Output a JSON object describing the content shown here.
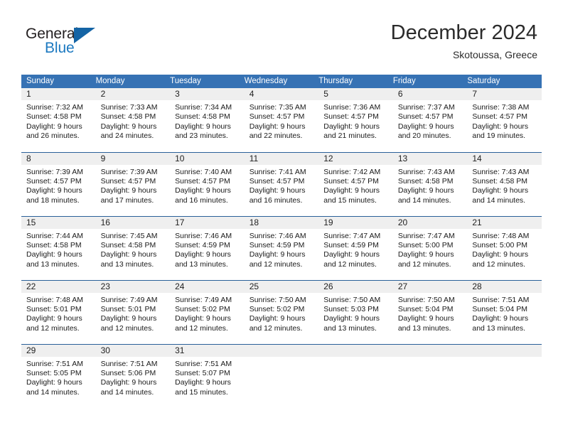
{
  "brand": {
    "name_part1": "General",
    "name_part2": "Blue"
  },
  "header": {
    "title": "December 2024",
    "location": "Skotoussa, Greece"
  },
  "colors": {
    "header_blue": "#3672b4",
    "row_border_blue": "#2a6099",
    "daynum_bg": "#efefef",
    "logo_blue": "#1c79c0",
    "logo_dark": "#231f20"
  },
  "weekdays": [
    "Sunday",
    "Monday",
    "Tuesday",
    "Wednesday",
    "Thursday",
    "Friday",
    "Saturday"
  ],
  "weeks": [
    [
      {
        "day": "1",
        "sunrise": "Sunrise: 7:32 AM",
        "sunset": "Sunset: 4:58 PM",
        "daylight1": "Daylight: 9 hours",
        "daylight2": "and 26 minutes."
      },
      {
        "day": "2",
        "sunrise": "Sunrise: 7:33 AM",
        "sunset": "Sunset: 4:58 PM",
        "daylight1": "Daylight: 9 hours",
        "daylight2": "and 24 minutes."
      },
      {
        "day": "3",
        "sunrise": "Sunrise: 7:34 AM",
        "sunset": "Sunset: 4:58 PM",
        "daylight1": "Daylight: 9 hours",
        "daylight2": "and 23 minutes."
      },
      {
        "day": "4",
        "sunrise": "Sunrise: 7:35 AM",
        "sunset": "Sunset: 4:57 PM",
        "daylight1": "Daylight: 9 hours",
        "daylight2": "and 22 minutes."
      },
      {
        "day": "5",
        "sunrise": "Sunrise: 7:36 AM",
        "sunset": "Sunset: 4:57 PM",
        "daylight1": "Daylight: 9 hours",
        "daylight2": "and 21 minutes."
      },
      {
        "day": "6",
        "sunrise": "Sunrise: 7:37 AM",
        "sunset": "Sunset: 4:57 PM",
        "daylight1": "Daylight: 9 hours",
        "daylight2": "and 20 minutes."
      },
      {
        "day": "7",
        "sunrise": "Sunrise: 7:38 AM",
        "sunset": "Sunset: 4:57 PM",
        "daylight1": "Daylight: 9 hours",
        "daylight2": "and 19 minutes."
      }
    ],
    [
      {
        "day": "8",
        "sunrise": "Sunrise: 7:39 AM",
        "sunset": "Sunset: 4:57 PM",
        "daylight1": "Daylight: 9 hours",
        "daylight2": "and 18 minutes."
      },
      {
        "day": "9",
        "sunrise": "Sunrise: 7:39 AM",
        "sunset": "Sunset: 4:57 PM",
        "daylight1": "Daylight: 9 hours",
        "daylight2": "and 17 minutes."
      },
      {
        "day": "10",
        "sunrise": "Sunrise: 7:40 AM",
        "sunset": "Sunset: 4:57 PM",
        "daylight1": "Daylight: 9 hours",
        "daylight2": "and 16 minutes."
      },
      {
        "day": "11",
        "sunrise": "Sunrise: 7:41 AM",
        "sunset": "Sunset: 4:57 PM",
        "daylight1": "Daylight: 9 hours",
        "daylight2": "and 16 minutes."
      },
      {
        "day": "12",
        "sunrise": "Sunrise: 7:42 AM",
        "sunset": "Sunset: 4:57 PM",
        "daylight1": "Daylight: 9 hours",
        "daylight2": "and 15 minutes."
      },
      {
        "day": "13",
        "sunrise": "Sunrise: 7:43 AM",
        "sunset": "Sunset: 4:58 PM",
        "daylight1": "Daylight: 9 hours",
        "daylight2": "and 14 minutes."
      },
      {
        "day": "14",
        "sunrise": "Sunrise: 7:43 AM",
        "sunset": "Sunset: 4:58 PM",
        "daylight1": "Daylight: 9 hours",
        "daylight2": "and 14 minutes."
      }
    ],
    [
      {
        "day": "15",
        "sunrise": "Sunrise: 7:44 AM",
        "sunset": "Sunset: 4:58 PM",
        "daylight1": "Daylight: 9 hours",
        "daylight2": "and 13 minutes."
      },
      {
        "day": "16",
        "sunrise": "Sunrise: 7:45 AM",
        "sunset": "Sunset: 4:58 PM",
        "daylight1": "Daylight: 9 hours",
        "daylight2": "and 13 minutes."
      },
      {
        "day": "17",
        "sunrise": "Sunrise: 7:46 AM",
        "sunset": "Sunset: 4:59 PM",
        "daylight1": "Daylight: 9 hours",
        "daylight2": "and 13 minutes."
      },
      {
        "day": "18",
        "sunrise": "Sunrise: 7:46 AM",
        "sunset": "Sunset: 4:59 PM",
        "daylight1": "Daylight: 9 hours",
        "daylight2": "and 12 minutes."
      },
      {
        "day": "19",
        "sunrise": "Sunrise: 7:47 AM",
        "sunset": "Sunset: 4:59 PM",
        "daylight1": "Daylight: 9 hours",
        "daylight2": "and 12 minutes."
      },
      {
        "day": "20",
        "sunrise": "Sunrise: 7:47 AM",
        "sunset": "Sunset: 5:00 PM",
        "daylight1": "Daylight: 9 hours",
        "daylight2": "and 12 minutes."
      },
      {
        "day": "21",
        "sunrise": "Sunrise: 7:48 AM",
        "sunset": "Sunset: 5:00 PM",
        "daylight1": "Daylight: 9 hours",
        "daylight2": "and 12 minutes."
      }
    ],
    [
      {
        "day": "22",
        "sunrise": "Sunrise: 7:48 AM",
        "sunset": "Sunset: 5:01 PM",
        "daylight1": "Daylight: 9 hours",
        "daylight2": "and 12 minutes."
      },
      {
        "day": "23",
        "sunrise": "Sunrise: 7:49 AM",
        "sunset": "Sunset: 5:01 PM",
        "daylight1": "Daylight: 9 hours",
        "daylight2": "and 12 minutes."
      },
      {
        "day": "24",
        "sunrise": "Sunrise: 7:49 AM",
        "sunset": "Sunset: 5:02 PM",
        "daylight1": "Daylight: 9 hours",
        "daylight2": "and 12 minutes."
      },
      {
        "day": "25",
        "sunrise": "Sunrise: 7:50 AM",
        "sunset": "Sunset: 5:02 PM",
        "daylight1": "Daylight: 9 hours",
        "daylight2": "and 12 minutes."
      },
      {
        "day": "26",
        "sunrise": "Sunrise: 7:50 AM",
        "sunset": "Sunset: 5:03 PM",
        "daylight1": "Daylight: 9 hours",
        "daylight2": "and 13 minutes."
      },
      {
        "day": "27",
        "sunrise": "Sunrise: 7:50 AM",
        "sunset": "Sunset: 5:04 PM",
        "daylight1": "Daylight: 9 hours",
        "daylight2": "and 13 minutes."
      },
      {
        "day": "28",
        "sunrise": "Sunrise: 7:51 AM",
        "sunset": "Sunset: 5:04 PM",
        "daylight1": "Daylight: 9 hours",
        "daylight2": "and 13 minutes."
      }
    ],
    [
      {
        "day": "29",
        "sunrise": "Sunrise: 7:51 AM",
        "sunset": "Sunset: 5:05 PM",
        "daylight1": "Daylight: 9 hours",
        "daylight2": "and 14 minutes."
      },
      {
        "day": "30",
        "sunrise": "Sunrise: 7:51 AM",
        "sunset": "Sunset: 5:06 PM",
        "daylight1": "Daylight: 9 hours",
        "daylight2": "and 14 minutes."
      },
      {
        "day": "31",
        "sunrise": "Sunrise: 7:51 AM",
        "sunset": "Sunset: 5:07 PM",
        "daylight1": "Daylight: 9 hours",
        "daylight2": "and 15 minutes."
      },
      {
        "day": "",
        "sunrise": "",
        "sunset": "",
        "daylight1": "",
        "daylight2": ""
      },
      {
        "day": "",
        "sunrise": "",
        "sunset": "",
        "daylight1": "",
        "daylight2": ""
      },
      {
        "day": "",
        "sunrise": "",
        "sunset": "",
        "daylight1": "",
        "daylight2": ""
      },
      {
        "day": "",
        "sunrise": "",
        "sunset": "",
        "daylight1": "",
        "daylight2": ""
      }
    ]
  ]
}
